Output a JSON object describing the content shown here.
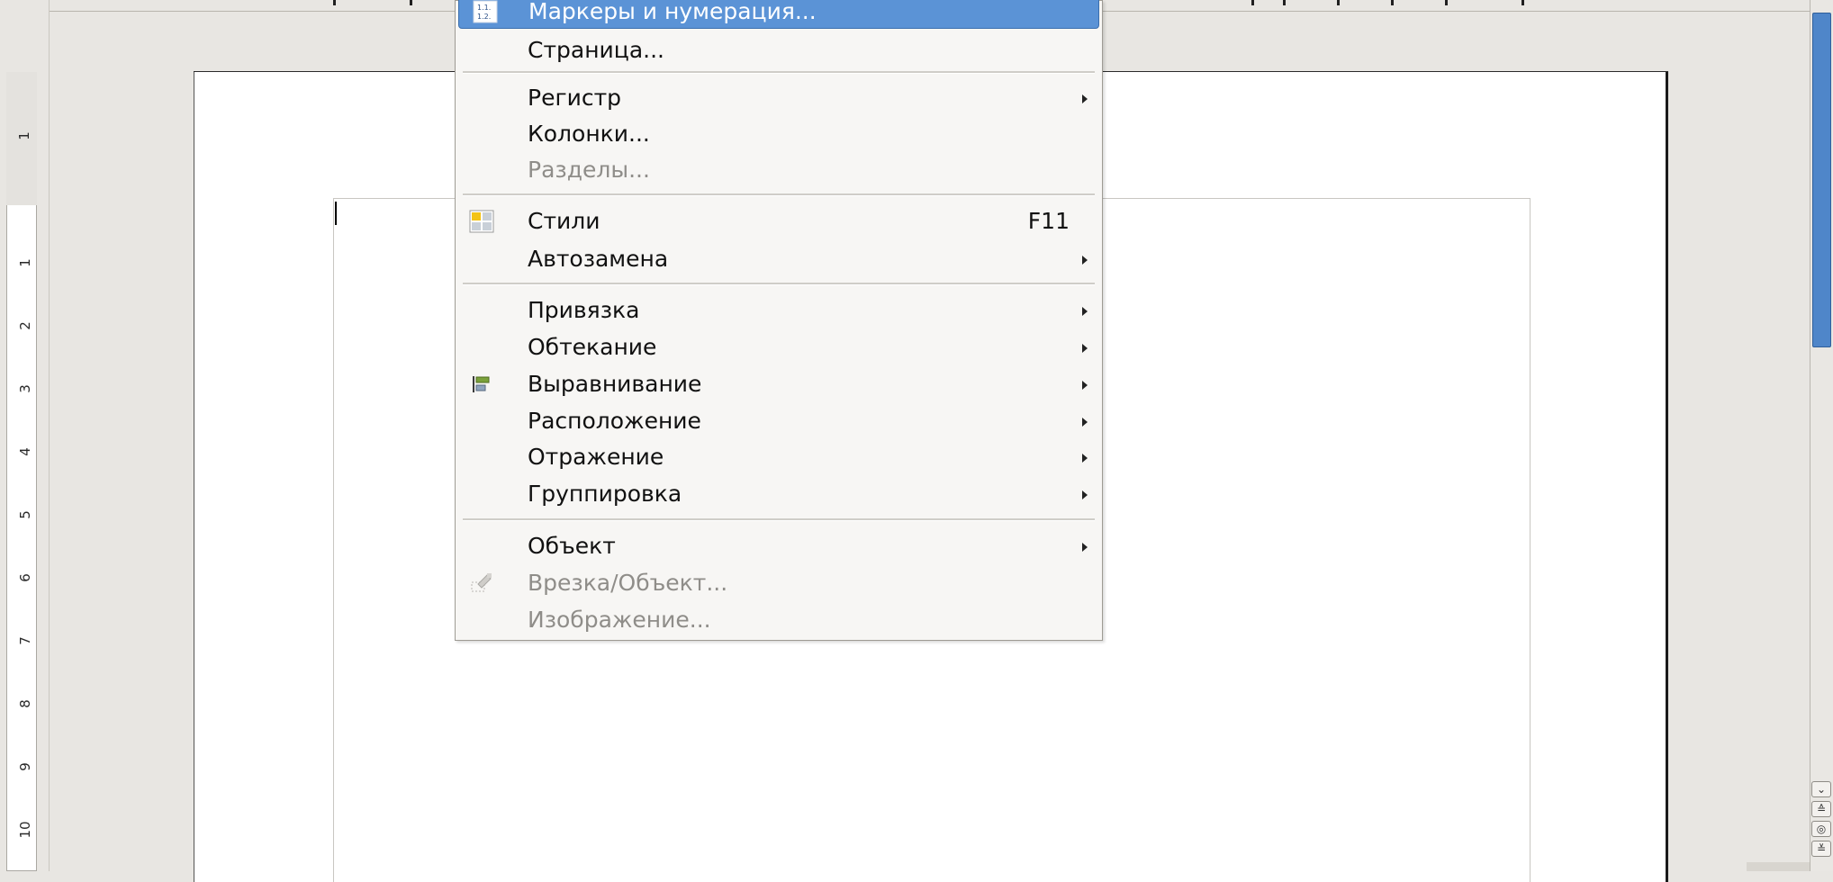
{
  "menu": {
    "items": [
      {
        "label": "Маркеры и нумерация...",
        "icon": "bullets-numbering-icon",
        "highlighted": true
      },
      {
        "label": "Страница..."
      },
      {
        "label": "Регистр",
        "submenu": true
      },
      {
        "label": "Колонки..."
      },
      {
        "label": "Разделы...",
        "disabled": true
      },
      {
        "label": "Стили",
        "icon": "styles-icon",
        "accelerator": "F11"
      },
      {
        "label": "Автозамена",
        "submenu": true
      },
      {
        "label": "Привязка",
        "submenu": true
      },
      {
        "label": "Обтекание",
        "submenu": true
      },
      {
        "label": "Выравнивание",
        "icon": "align-icon",
        "submenu": true
      },
      {
        "label": "Расположение",
        "submenu": true
      },
      {
        "label": "Отражение",
        "submenu": true
      },
      {
        "label": "Группировка",
        "submenu": true
      },
      {
        "label": "Объект",
        "submenu": true
      },
      {
        "label": "Врезка/Объект...",
        "icon": "frame-object-icon",
        "disabled": true
      },
      {
        "label": "Изображение...",
        "disabled": true
      }
    ]
  },
  "ruler": {
    "numbers": [
      "1",
      "1",
      "2",
      "3",
      "4",
      "5",
      "6",
      "7",
      "8",
      "9",
      "10"
    ]
  },
  "colors": {
    "highlight": "#5b93d6",
    "scroll_thumb": "#4f86c9",
    "disabled_text": "#8f8d89"
  }
}
